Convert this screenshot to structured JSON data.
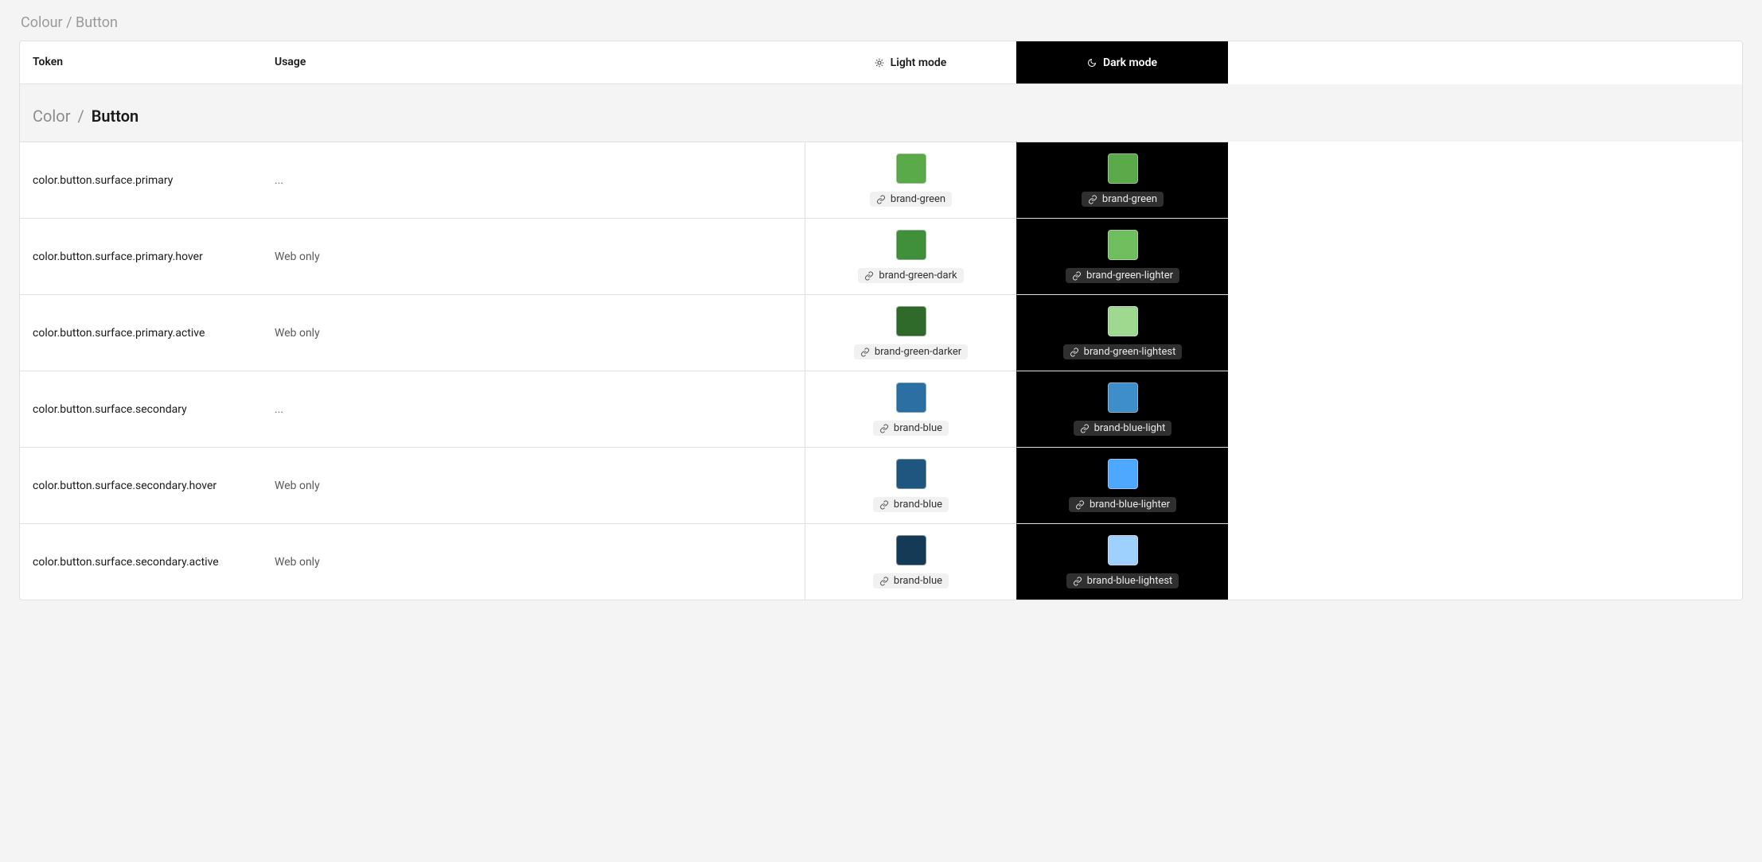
{
  "breadcrumb": "Colour / Button",
  "columns": {
    "token": "Token",
    "usage": "Usage",
    "light": "Light mode",
    "dark": "Dark mode"
  },
  "section": {
    "prefix": "Color",
    "sep": "/",
    "name": "Button"
  },
  "rows": [
    {
      "token": "color.button.surface.primary",
      "usage": "...",
      "light": {
        "alias": "brand-green",
        "hex": "#5aaa4a"
      },
      "dark": {
        "alias": "brand-green",
        "hex": "#5aaa4a"
      }
    },
    {
      "token": "color.button.surface.primary.hover",
      "usage": "Web only",
      "light": {
        "alias": "brand-green-dark",
        "hex": "#3f8f3b"
      },
      "dark": {
        "alias": "brand-green-lighter",
        "hex": "#6fbf5f"
      }
    },
    {
      "token": "color.button.surface.primary.active",
      "usage": "Web only",
      "light": {
        "alias": "brand-green-darker",
        "hex": "#2f6a2a"
      },
      "dark": {
        "alias": "brand-green-lightest",
        "hex": "#9ed98f"
      }
    },
    {
      "token": "color.button.surface.secondary",
      "usage": "...",
      "light": {
        "alias": "brand-blue",
        "hex": "#2b6fa3"
      },
      "dark": {
        "alias": "brand-blue-light",
        "hex": "#3e8fc9"
      }
    },
    {
      "token": "color.button.surface.secondary.hover",
      "usage": "Web only",
      "light": {
        "alias": "brand-blue",
        "hex": "#1f567f"
      },
      "dark": {
        "alias": "brand-blue-lighter",
        "hex": "#4fa8ff"
      }
    },
    {
      "token": "color.button.surface.secondary.active",
      "usage": "Web only",
      "light": {
        "alias": "brand-blue",
        "hex": "#143a56"
      },
      "dark": {
        "alias": "brand-blue-lightest",
        "hex": "#9fd1ff"
      }
    }
  ]
}
